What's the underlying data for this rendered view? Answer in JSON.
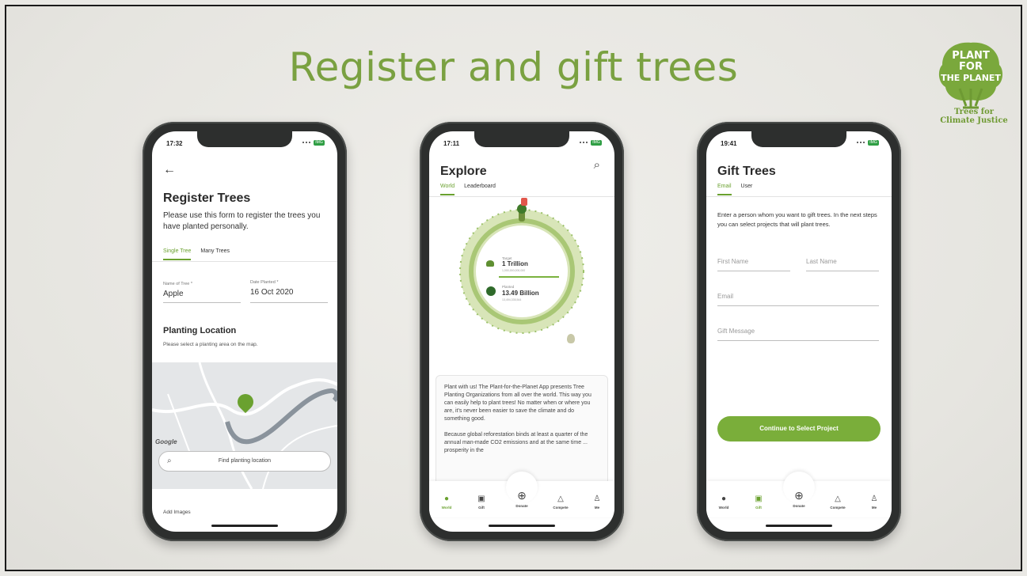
{
  "slide": {
    "title": "Register and gift trees",
    "logo": {
      "lines": [
        "PLANT",
        "FOR",
        "THE PLANET"
      ],
      "tagline_1": "Trees for",
      "tagline_2": "Climate Justice"
    }
  },
  "phone1": {
    "time": "17:32",
    "battery": "IMG",
    "heading": "Register Trees",
    "description": "Please use this form to register the trees you have planted personally.",
    "tabs": [
      "Single Tree",
      "Many Trees"
    ],
    "tree_name_label": "Name of Tree *",
    "tree_name_value": "Apple",
    "date_label": "Date Planted *",
    "date_value": "16 Oct 2020",
    "location_heading": "Planting Location",
    "location_hint": "Please select a planting area on the map.",
    "map_brand": "Google",
    "find_location": "Find planting location",
    "add_images": "Add Images"
  },
  "phone2": {
    "time": "17:11",
    "battery": "IMG",
    "heading": "Explore",
    "tabs": [
      "World",
      "Leaderboard"
    ],
    "target_label": "Target",
    "target_value": "1 Trillion",
    "target_exact": "1,000,000,000,000",
    "planted_label": "Planted",
    "planted_value": "13.49 Billion",
    "planted_exact": "13,494,335,544",
    "paragraph1": "Plant with us! The Plant-for-the-Planet App presents Tree Planting Organizations from all over the world. This way you can easily help to plant trees! No matter when or where you are, it's never been easier to save the climate and do something good.",
    "paragraph2": "Because global reforestation binds at least a quarter of the annual man-made CO2 emissions and at the same time ... prosperity in the",
    "nav": [
      "World",
      "Gift",
      "Donate",
      "Compete",
      "Me"
    ]
  },
  "phone3": {
    "time": "19:41",
    "battery": "IMG",
    "heading": "Gift Trees",
    "tabs": [
      "Email",
      "User"
    ],
    "description": "Enter a person whom you want to gift trees. In the next steps you can select projects that will plant trees.",
    "first_name": "First Name",
    "last_name": "Last Name",
    "email": "Email",
    "gift_message": "Gift Message",
    "cta": "Continue to Select Project",
    "nav": [
      "World",
      "Gift",
      "Donate",
      "Compete",
      "Me"
    ]
  },
  "colors": {
    "accent": "#6aa12f",
    "title": "#7aa141",
    "button": "#7aae3a",
    "globe_ring": "#c9d9a3"
  },
  "icons": [
    "back-arrow-icon",
    "search-icon",
    "map-pin-icon",
    "globe-icon",
    "gift-icon",
    "donate-hand-icon",
    "trophy-icon",
    "person-icon"
  ]
}
